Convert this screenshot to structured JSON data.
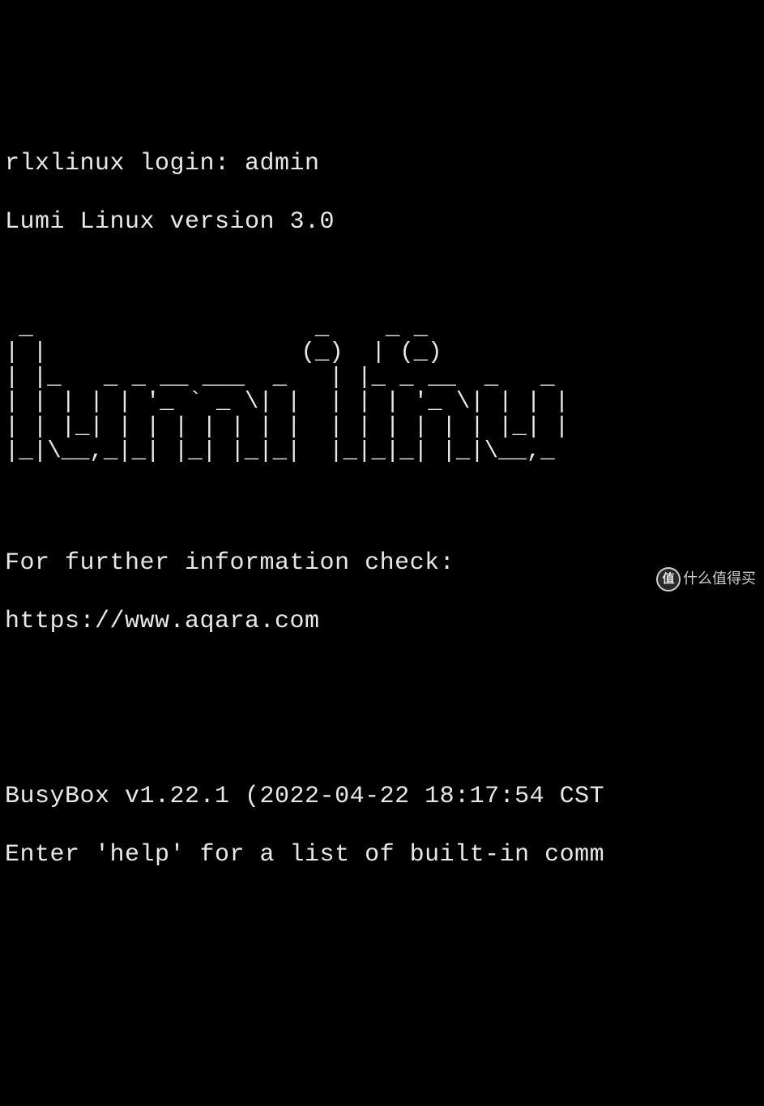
{
  "terminal": {
    "login_line": "rlxlinux login: admin",
    "version_line": "Lumi Linux version 3.0",
    "ascii_art": " _                    _    _ _\n| |                  (_)  | (_)\n| |_   _ _ __ ___  _   | |_ _ __  _   _\n| | | | | '_ ` _ \\| |  | | | '_ \\| | | |\n| | |_| | | | | | | |  | | | | | | |_| |\n|_|\\__,_|_| |_| |_|_|  |_|_|_| |_|\\__,_",
    "info_line": "For further information check:",
    "url_line": "https://www.aqara.com",
    "busybox_line": "BusyBox v1.22.1 (2022-04-22 18:17:54 CST",
    "help_line": "Enter 'help' for a list of built-in comm"
  },
  "watermark": {
    "badge": "值",
    "text": "什么值得买"
  }
}
